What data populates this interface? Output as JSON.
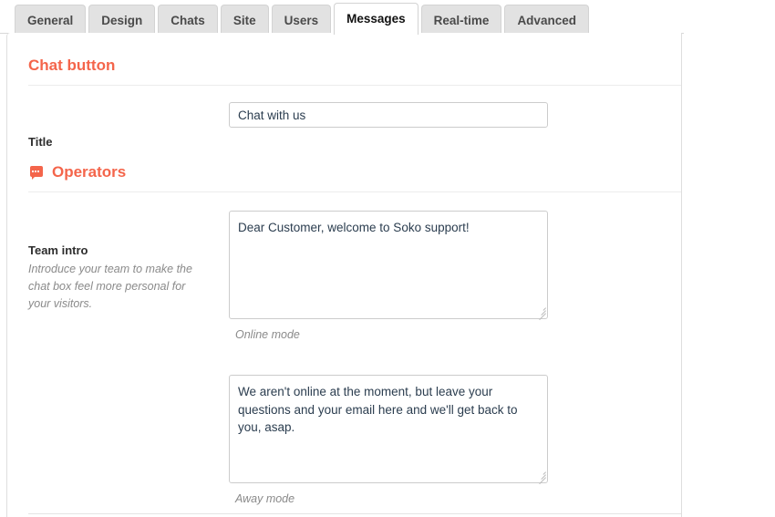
{
  "tabs": [
    {
      "label": "General",
      "active": false
    },
    {
      "label": "Design",
      "active": false
    },
    {
      "label": "Chats",
      "active": false
    },
    {
      "label": "Site",
      "active": false
    },
    {
      "label": "Users",
      "active": false
    },
    {
      "label": "Messages",
      "active": true
    },
    {
      "label": "Real-time",
      "active": false
    },
    {
      "label": "Advanced",
      "active": false
    }
  ],
  "sections": {
    "chat_button": {
      "title": "Chat button",
      "title_field": {
        "label": "Title",
        "value": "Chat with us",
        "placeholder": ""
      }
    },
    "operators": {
      "title": "Operators",
      "icon": "chat-bubble-icon",
      "team_intro": {
        "label": "Team intro",
        "help": "Introduce your team to make the chat box feel more personal for your visitors.",
        "online": {
          "value": "Dear Customer, welcome to Soko support!",
          "caption": "Online mode",
          "placeholder": ""
        },
        "away": {
          "value": "We aren't online at the moment, but leave your questions and your email here and we'll get back to you, asap.",
          "caption": "Away mode",
          "placeholder": ""
        }
      }
    }
  },
  "colors": {
    "accent": "#f4654b",
    "tab_inactive_bg": "#e2e2e2",
    "tab_active_bg": "#ffffff",
    "input_text": "#2b3d4f",
    "help_text": "#8a8a8a"
  }
}
